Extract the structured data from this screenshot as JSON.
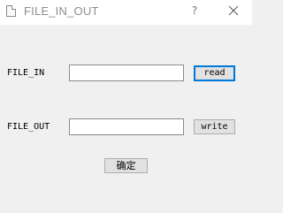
{
  "window": {
    "title": "FILE_IN_OUT",
    "help_label": "?",
    "icons": {
      "app": "document-icon",
      "close": "close-icon"
    }
  },
  "file_in": {
    "label": "FILE_IN",
    "value": "",
    "button_label": "read"
  },
  "file_out": {
    "label": "FILE_OUT",
    "value": "",
    "button_label": "write"
  },
  "confirm_button_label": "确定",
  "colors": {
    "focus_accent": "#0078d7",
    "window_bg": "#f0f0f0",
    "titlebar_bg": "#ffffff"
  }
}
